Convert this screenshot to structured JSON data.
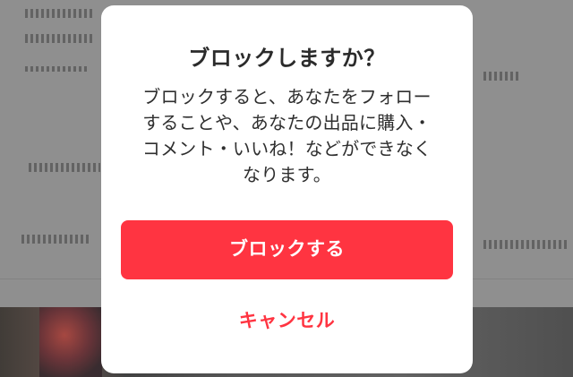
{
  "dialog": {
    "title": "ブロックしますか？",
    "message_lines": [
      "ブロックすると、あなたをフォロー",
      "することや、あなたの出品に購入・",
      "コメント・いいね！などができなく",
      "なります。"
    ],
    "confirm_label": "ブロックする",
    "cancel_label": "キャンセル",
    "confirm_color": "#ff3441",
    "cancel_text_color": "#ff3441"
  }
}
